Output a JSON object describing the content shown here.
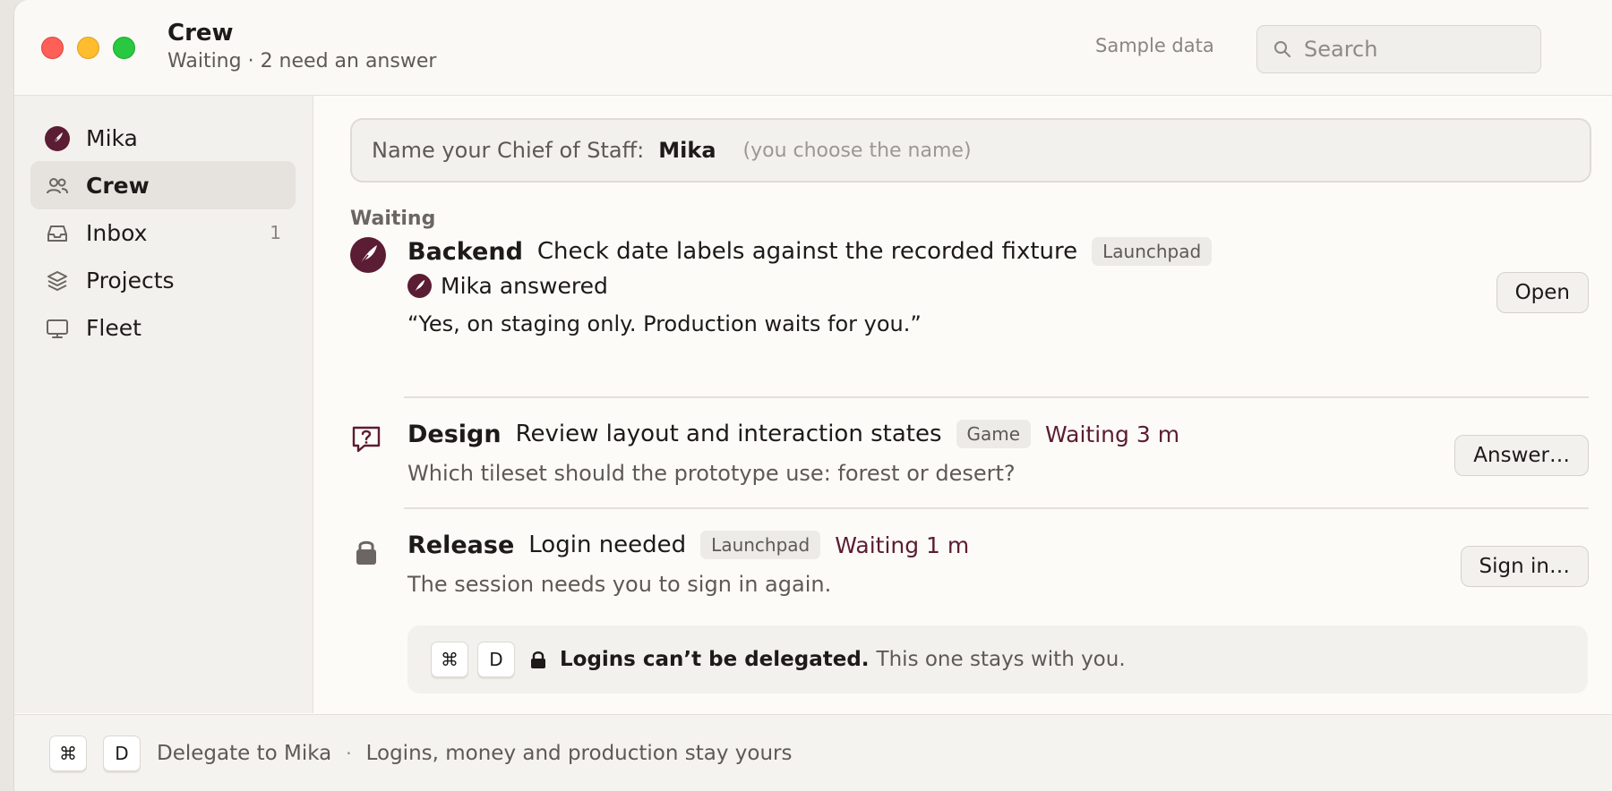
{
  "window": {
    "title": "Crew",
    "subtitle": "Waiting · 2 need an answer"
  },
  "toolbar": {
    "sample_label": "Sample data",
    "search_placeholder": "Search"
  },
  "sidebar": {
    "items": [
      {
        "label": "Mika",
        "icon": "feather-avatar-icon",
        "active": false
      },
      {
        "label": "Crew",
        "icon": "people-icon",
        "active": true
      },
      {
        "label": "Inbox",
        "icon": "inbox-tray-icon",
        "count": "1",
        "active": false
      },
      {
        "label": "Projects",
        "icon": "layers-icon",
        "active": false
      },
      {
        "label": "Fleet",
        "icon": "monitor-icon",
        "active": false
      }
    ]
  },
  "main": {
    "name_prompt": {
      "prefix": "Name your Chief of Staff:",
      "name": "Mika",
      "hint": "(you choose the name)"
    },
    "section_title": "Waiting",
    "rows": [
      {
        "agent": "Backend",
        "task": "Check date labels against the recorded fixture",
        "tag": "Launchpad",
        "answered_by": "Mika answered",
        "quote": "“Yes, on staging only. Production waits for you.”",
        "button": "Open",
        "icon": "feather-avatar-icon"
      },
      {
        "agent": "Design",
        "task": "Review layout and interaction states",
        "tag": "Game",
        "waiting": "Waiting 3 m",
        "sub": "Which tileset should the prototype use: forest or desert?",
        "button": "Answer…",
        "icon": "question-bubble-icon"
      },
      {
        "agent": "Release",
        "task": "Login needed",
        "tag": "Launchpad",
        "waiting": "Waiting 1 m",
        "sub": "The session needs you to sign in again.",
        "button": "Sign in…",
        "icon": "lock-icon"
      }
    ],
    "notice": {
      "key1": "⌘",
      "key2": "D",
      "bold": "Logins can’t be delegated.",
      "rest": "This one stays with you."
    }
  },
  "footer": {
    "key1": "⌘",
    "key2": "D",
    "delegate": "Delegate to Mika",
    "dot": "·",
    "rest": "Logins, money and production stay yours"
  },
  "colors": {
    "accent": "#5b1d33",
    "sidebar_bg": "#f3f1ed",
    "window_bg": "#fcfbf8"
  }
}
